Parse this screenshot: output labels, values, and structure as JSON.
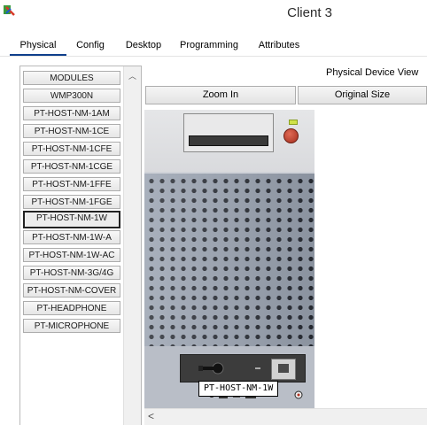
{
  "window": {
    "title": "Client 3",
    "icon": "packet-tracer-icon"
  },
  "tabs": [
    {
      "label": "Physical",
      "active": true
    },
    {
      "label": "Config",
      "active": false
    },
    {
      "label": "Desktop",
      "active": false
    },
    {
      "label": "Programming",
      "active": false
    },
    {
      "label": "Attributes",
      "active": false
    }
  ],
  "modules": {
    "header": "MODULES",
    "items": [
      "WMP300N",
      "PT-HOST-NM-1AM",
      "PT-HOST-NM-1CE",
      "PT-HOST-NM-1CFE",
      "PT-HOST-NM-1CGE",
      "PT-HOST-NM-1FFE",
      "PT-HOST-NM-1FGE",
      "PT-HOST-NM-1W",
      "PT-HOST-NM-1W-A",
      "PT-HOST-NM-1W-AC",
      "PT-HOST-NM-3G/4G",
      "PT-HOST-NM-COVER",
      "PT-HEADPHONE",
      "PT-MICROPHONE"
    ],
    "selected": "PT-HOST-NM-1W"
  },
  "physical_view": {
    "title": "Physical Device View",
    "zoom_in_label": "Zoom In",
    "original_size_label": "Original Size",
    "tooltip": "PT-HOST-NM-1W"
  },
  "colors": {
    "active_tab_underline": "#0f3f8c",
    "chassis_top": "#e5e6e8",
    "grille": "#9aa3b1",
    "power_button": "#c0392b"
  }
}
